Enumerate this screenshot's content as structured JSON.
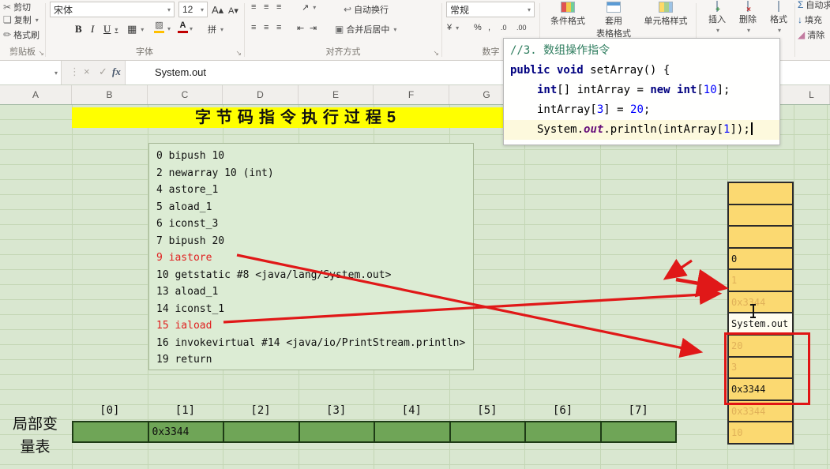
{
  "icons": {
    "scissors": "✂",
    "copy": "❏",
    "format_painter": "✏",
    "dropdown": "▾",
    "launcher": "↘",
    "grow_font": "A▴",
    "shrink_font": "A▾",
    "bold": "B",
    "italic": "I",
    "underline": "U",
    "borders": "▦",
    "fill_color": "▨",
    "font_color": "A",
    "phonetic": "拼",
    "align_lines": "≡",
    "orientation": "↗",
    "wrap": "↩",
    "indent_left": "⇤",
    "indent_right": "⇥",
    "merge": "▣",
    "currency": "¥",
    "percent": "%",
    "comma": ",",
    "dec_inc": ".0",
    "dec_dec": ".00",
    "insert_badge": "+",
    "delete_badge": "×",
    "sum": "Σ",
    "fill_down": "↓",
    "clear": "◢",
    "cancel": "×",
    "enter": "✓",
    "fx": "fx",
    "name_dropdown": "▾"
  },
  "colors": {
    "arrow_red": "#e01818",
    "red_text": "#e02020",
    "banner_yellow": "#ffff00",
    "stack_fill": "#fbd971",
    "stack_faded_text": "#e0b159",
    "lvt_green": "#6fa557",
    "sheet_green": "#d9e7d0"
  },
  "ribbon": {
    "clipboard": {
      "cut": "剪切",
      "copy": "复制",
      "painter": "格式刷",
      "group": "剪贴板"
    },
    "font": {
      "family": "宋体",
      "size": "12",
      "group": "字体"
    },
    "alignment": {
      "wrap": "自动换行",
      "merge": "合并后居中",
      "group": "对齐方式"
    },
    "number": {
      "format": "常规",
      "group": "数字"
    },
    "styles": {
      "conditional": "条件格式",
      "table_1": "套用",
      "table_2": "表格格式",
      "cell": "单元格样式"
    },
    "cells": {
      "insert": "插入",
      "delete": "删除",
      "format": "格式"
    },
    "editing": {
      "sum": "自动求和",
      "fill": "填充",
      "clear": "清除"
    }
  },
  "formula_bar": {
    "name_box": "",
    "value": "System.out"
  },
  "columns": {
    "headers": [
      {
        "label": "A",
        "col": 0
      },
      {
        "label": "B",
        "col": 1
      },
      {
        "label": "C",
        "col": 2
      },
      {
        "label": "D",
        "col": 3
      },
      {
        "label": "E",
        "col": 4
      },
      {
        "label": "F",
        "col": 5
      },
      {
        "label": "G",
        "col": 6
      },
      {
        "label": "L",
        "col": 11
      }
    ]
  },
  "code_panel": {
    "lines": [
      {
        "indent": 0,
        "highlight": false,
        "tokens": [
          {
            "t": "//3. 数组操作指令",
            "c": "comment"
          }
        ]
      },
      {
        "indent": 0,
        "highlight": false,
        "tokens": [
          {
            "t": "public void ",
            "c": "kw"
          },
          {
            "t": "setArray() {",
            "c": "plain"
          }
        ]
      },
      {
        "indent": 1,
        "highlight": false,
        "tokens": [
          {
            "t": "int",
            "c": "kw"
          },
          {
            "t": "[] intArray = ",
            "c": "plain"
          },
          {
            "t": "new int",
            "c": "kw"
          },
          {
            "t": "[",
            "c": "plain"
          },
          {
            "t": "10",
            "c": "num"
          },
          {
            "t": "];",
            "c": "plain"
          }
        ]
      },
      {
        "indent": 1,
        "highlight": false,
        "tokens": [
          {
            "t": "intArray[",
            "c": "plain"
          },
          {
            "t": "3",
            "c": "num"
          },
          {
            "t": "] = ",
            "c": "plain"
          },
          {
            "t": "20",
            "c": "num"
          },
          {
            "t": ";",
            "c": "plain"
          }
        ]
      },
      {
        "indent": 1,
        "highlight": true,
        "caret": true,
        "tokens": [
          {
            "t": "System.",
            "c": "plain"
          },
          {
            "t": "out",
            "c": "field"
          },
          {
            "t": ".println(intArray[",
            "c": "plain"
          },
          {
            "t": "1",
            "c": "num"
          },
          {
            "t": "]);",
            "c": "plain"
          }
        ]
      }
    ]
  },
  "sheet": {
    "banner": "字节码指令执行过程5",
    "bytecode": [
      {
        "text": "0 bipush 10",
        "red": false
      },
      {
        "text": "2 newarray 10 (int)",
        "red": false
      },
      {
        "text": "4 astore_1",
        "red": false
      },
      {
        "text": "5 aload_1",
        "red": false
      },
      {
        "text": "6 iconst_3",
        "red": false
      },
      {
        "text": "7 bipush 20",
        "red": false
      },
      {
        "text": "9 iastore",
        "red": true
      },
      {
        "text": "10 getstatic #8 <java/lang/System.out>",
        "red": false
      },
      {
        "text": "13 aload_1",
        "red": false
      },
      {
        "text": "14 iconst_1",
        "red": false
      },
      {
        "text": "15 iaload",
        "red": true
      },
      {
        "text": "16 invokevirtual #14 <java/io/PrintStream.println>",
        "red": false
      },
      {
        "text": "19 return",
        "red": false
      }
    ],
    "stack_cells": [
      {
        "text": "",
        "style": "normal"
      },
      {
        "text": "",
        "style": "normal"
      },
      {
        "text": "",
        "style": "normal"
      },
      {
        "text": "0",
        "style": "dark"
      },
      {
        "text": "1",
        "style": "faded"
      },
      {
        "text": "0x3344",
        "style": "faded"
      },
      {
        "text": "System.out",
        "style": "white"
      },
      {
        "text": "20",
        "style": "faded"
      },
      {
        "text": "3",
        "style": "faded"
      },
      {
        "text": "0x3344",
        "style": "dark"
      },
      {
        "text": "0x3344",
        "style": "faded"
      },
      {
        "text": "10",
        "style": "faded"
      }
    ],
    "lvt": {
      "label_line1": "局部变",
      "label_line2": "量表",
      "indices": [
        "[0]",
        "[1]",
        "[2]",
        "[3]",
        "[4]",
        "[5]",
        "[6]",
        "[7]"
      ],
      "values": [
        "",
        "0x3344",
        "",
        "",
        "",
        "",
        "",
        ""
      ]
    }
  }
}
